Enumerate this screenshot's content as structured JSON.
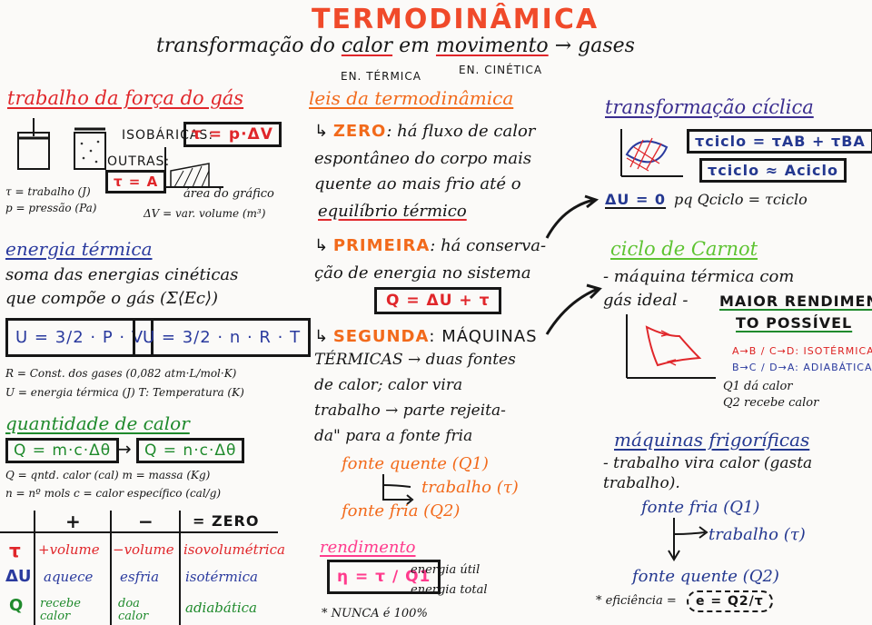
{
  "header": {
    "title": "TERMODINÂMICA",
    "subtitle_pre": "transformação do",
    "subtitle_calor": "calor",
    "subtitle_em": "em",
    "subtitle_movimento": "movimento",
    "subtitle_post": "→ gases",
    "label_en_termica": "EN. TÉRMICA",
    "label_en_cinetica": "EN. CINÉTICA"
  },
  "trabalho": {
    "title": "trabalho da força do gás",
    "isobaricas": "ISOBÁRICAS:",
    "formula_iso": "τ = p·ΔV",
    "outras": "OUTRAS:",
    "formula_outras": "τ = A",
    "area": "área do gráfico",
    "tau_def": "τ = trabalho (J)",
    "p_def": "p = pressão (Pa)",
    "dv_def": "ΔV = var. volume (m³)"
  },
  "energia": {
    "title": "energia térmica",
    "l1": "soma das energias cinéticas",
    "l2": "que compõe o gás (Σ⟨Ec⟩)",
    "f1": "U = 3/2 · P · V",
    "f2": "U = 3/2 · n · R · T",
    "r_def": "R = Const. dos gases (0,082 atm·L/mol·K)",
    "u_def": "U = energia térmica (J)  T: Temperatura (K)"
  },
  "quantidade": {
    "title": "quantidade de calor",
    "f1": "Q = m·c·Δθ",
    "arrow": "→",
    "f2": "Q = n·c·Δθ",
    "d1": "Q = qntd. calor (cal)   m = massa (Kg)",
    "d2": "n = nº mols   c = calor específico (cal/g)"
  },
  "table": {
    "headers": [
      "+",
      "−",
      "= ZERO"
    ],
    "rows": [
      {
        "sym": "τ",
        "c1": "+volume",
        "c2": "−volume",
        "c3": "isovolumétrica"
      },
      {
        "sym": "ΔU",
        "c1": "aquece",
        "c2": "esfria",
        "c3": "isotérmica"
      },
      {
        "sym": "Q",
        "c1": "recebe calor",
        "c2": "doa calor",
        "c3": "adiabática"
      }
    ]
  },
  "leis": {
    "title": "leis da termodinâmica",
    "zero_label": "ZERO",
    "zero_text": [
      ": há fluxo de calor",
      "espontâneo do corpo mais",
      "quente ao mais frio até o",
      "equilíbrio térmico"
    ],
    "primeira_label": "PRIMEIRA",
    "primeira_text": [
      ": há conserva-",
      "ção de energia no sistema"
    ],
    "primeira_formula": "Q = ΔU + τ",
    "segunda_label": "SEGUNDA",
    "segunda_text": [
      ": MÁQUINAS",
      "TÉRMICAS → duas fontes",
      "de calor; calor vira",
      "trabalho → parte rejeita-",
      "da\" para a fonte fria"
    ],
    "fonte_quente": "fonte quente (Q1)",
    "trabalho": "trabalho (τ)",
    "fonte_fria": "fonte fria (Q2)"
  },
  "rendimento": {
    "title": "rendimento",
    "formula": "η = τ / Q1",
    "util": "energia útil",
    "total": "energia total",
    "nunca": "* NUNCA é 100%"
  },
  "ciclica": {
    "title": "transformação cíclica",
    "f1": "τciclo = τAB + τBA",
    "f2": "τciclo ≈ Aciclo",
    "du": "ΔU = 0",
    "du_text": "pq  Qciclo = τciclo"
  },
  "carnot": {
    "title": "ciclo de Carnot",
    "l1": "- máquina térmica com",
    "l2": "gás ideal -",
    "maior1": "MAIOR RENDIMEN",
    "maior2": "TO POSSÍVEL",
    "iso": "A→B / C→D: ISOTÉRMICA",
    "adia": "B→C / D→A: ADIABÁTICA",
    "q1": "Q1 dá calor",
    "q2": "Q2 recebe calor"
  },
  "frigorificas": {
    "title": "máquinas frigoríficas",
    "l1": "- trabalho vira calor (gasta",
    "l2": "trabalho).",
    "fonte_fria": "fonte fria (Q1)",
    "trabalho": "trabalho (τ)",
    "fonte_quente": "fonte quente (Q2)",
    "eficiencia": "* eficiência =",
    "e_formula": "e = Q2/τ"
  },
  "colors": {
    "red": "#e0262a",
    "orange": "#f26a1b",
    "blue": "#2a3a9e",
    "green": "#1f8a2c",
    "light_green": "#5ec332",
    "pink": "#ff3b8d",
    "purple": "#3a2d8f"
  }
}
